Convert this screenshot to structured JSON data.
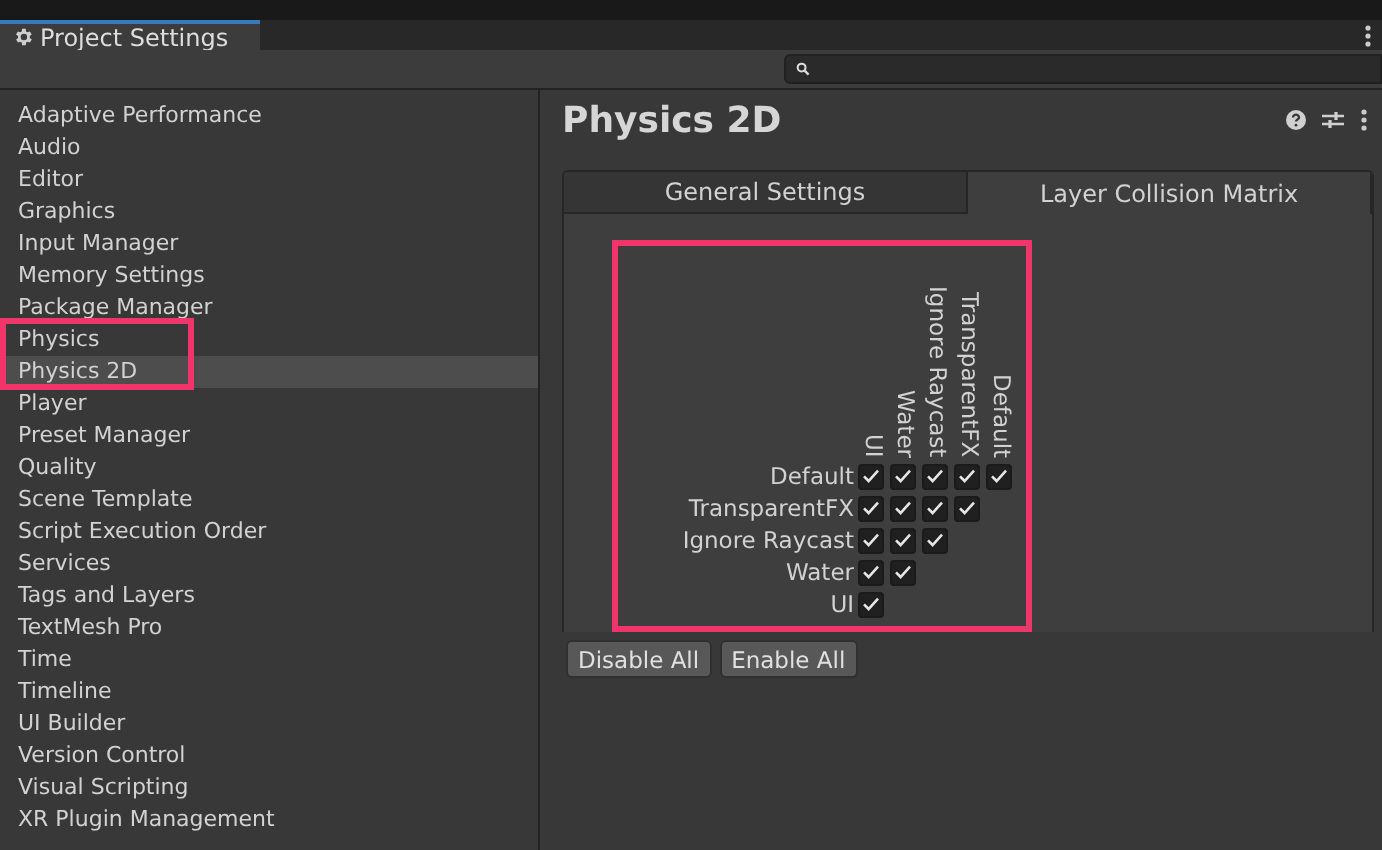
{
  "window": {
    "title": "Project Settings"
  },
  "sidebar": {
    "items": [
      {
        "label": "Adaptive Performance",
        "selected": false
      },
      {
        "label": "Audio",
        "selected": false
      },
      {
        "label": "Editor",
        "selected": false
      },
      {
        "label": "Graphics",
        "selected": false
      },
      {
        "label": "Input Manager",
        "selected": false
      },
      {
        "label": "Memory Settings",
        "selected": false
      },
      {
        "label": "Package Manager",
        "selected": false
      },
      {
        "label": "Physics",
        "selected": false
      },
      {
        "label": "Physics 2D",
        "selected": true
      },
      {
        "label": "Player",
        "selected": false
      },
      {
        "label": "Preset Manager",
        "selected": false
      },
      {
        "label": "Quality",
        "selected": false
      },
      {
        "label": "Scene Template",
        "selected": false
      },
      {
        "label": "Script Execution Order",
        "selected": false
      },
      {
        "label": "Services",
        "selected": false
      },
      {
        "label": "Tags and Layers",
        "selected": false
      },
      {
        "label": "TextMesh Pro",
        "selected": false
      },
      {
        "label": "Time",
        "selected": false
      },
      {
        "label": "Timeline",
        "selected": false
      },
      {
        "label": "UI Builder",
        "selected": false
      },
      {
        "label": "Version Control",
        "selected": false
      },
      {
        "label": "Visual Scripting",
        "selected": false
      },
      {
        "label": "XR Plugin Management",
        "selected": false
      }
    ]
  },
  "panel": {
    "title": "Physics 2D",
    "tabs": [
      {
        "label": "General Settings",
        "selected": false
      },
      {
        "label": "Layer Collision Matrix",
        "selected": true
      }
    ],
    "matrix": {
      "columns": [
        "UI",
        "Water",
        "Ignore Raycast",
        "TransparentFX",
        "Default"
      ],
      "rows": [
        {
          "label": "Default",
          "cells": [
            {
              "checked": true
            },
            {
              "checked": true
            },
            {
              "checked": true
            },
            {
              "checked": true
            },
            {
              "checked": true
            }
          ]
        },
        {
          "label": "TransparentFX",
          "cells": [
            {
              "checked": true
            },
            {
              "checked": true
            },
            {
              "checked": true
            },
            {
              "checked": true
            }
          ]
        },
        {
          "label": "Ignore Raycast",
          "cells": [
            {
              "checked": true
            },
            {
              "checked": true
            },
            {
              "checked": true
            }
          ]
        },
        {
          "label": "Water",
          "cells": [
            {
              "checked": true
            },
            {
              "checked": true
            }
          ]
        },
        {
          "label": "UI",
          "cells": [
            {
              "checked": true
            }
          ]
        }
      ]
    },
    "buttons": [
      "Disable All",
      "Enable All"
    ]
  }
}
